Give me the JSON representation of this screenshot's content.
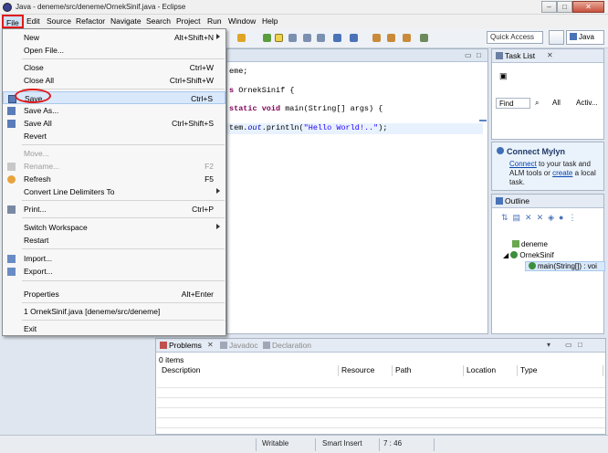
{
  "window": {
    "title": "Java - deneme/src/deneme/OrnekSinif.java - Eclipse",
    "minimize": "–",
    "maximize": "□",
    "close": "✕"
  },
  "menubar": [
    "File",
    "Edit",
    "Source",
    "Refactor",
    "Navigate",
    "Search",
    "Project",
    "Run",
    "Window",
    "Help"
  ],
  "toolbar": {
    "quick_access": "Quick Access",
    "perspective": "Java"
  },
  "editor": {
    "lines": [
      {
        "plain": "eme;"
      },
      {
        "kw": "s",
        "plain": " OrnekSinif {"
      },
      {
        "kw": "static void",
        "plain": " main(String[] args) {"
      },
      {
        "pre": "tem.",
        "it": "out",
        "post": ".println(",
        "str": "\"Hello World!..\"",
        "end": ");"
      }
    ]
  },
  "task_list": {
    "title": "Task List",
    "find_placeholder": "Find",
    "all": "All",
    "activate": "Activ..."
  },
  "mylyn": {
    "title": "Connect Mylyn",
    "connect_link": "Connect",
    "text_1": " to your task and ALM tools or ",
    "create_link": "create",
    "text_2": " a local task."
  },
  "outline": {
    "title": "Outline",
    "items": [
      "deneme",
      "OrnekSinif",
      "main(String[]) : voi"
    ]
  },
  "problems": {
    "tabs": [
      "Problems",
      "Javadoc",
      "Declaration"
    ],
    "count": "0 items",
    "columns": [
      "Description",
      "Resource",
      "Path",
      "Location",
      "Type"
    ]
  },
  "status": {
    "writable": "Writable",
    "insert_mode": "Smart Insert",
    "position": "7 : 46"
  },
  "file_menu": {
    "items": [
      {
        "label": "New",
        "accel": "Alt+Shift+N",
        "submenu": true,
        "disabled": false
      },
      {
        "label": "Open File...",
        "accel": "",
        "submenu": false,
        "disabled": false
      },
      {
        "label": "Close",
        "accel": "Ctrl+W",
        "submenu": false,
        "disabled": false
      },
      {
        "label": "Close All",
        "accel": "Ctrl+Shift+W",
        "submenu": false,
        "disabled": false
      },
      {
        "label": "Save",
        "accel": "Ctrl+S",
        "submenu": false,
        "disabled": false
      },
      {
        "label": "Save As...",
        "accel": "",
        "submenu": false,
        "disabled": false
      },
      {
        "label": "Save All",
        "accel": "Ctrl+Shift+S",
        "submenu": false,
        "disabled": false
      },
      {
        "label": "Revert",
        "accel": "",
        "submenu": false,
        "disabled": false
      },
      {
        "label": "Move...",
        "accel": "",
        "submenu": false,
        "disabled": true
      },
      {
        "label": "Rename...",
        "accel": "F2",
        "submenu": false,
        "disabled": true
      },
      {
        "label": "Refresh",
        "accel": "F5",
        "submenu": false,
        "disabled": false
      },
      {
        "label": "Convert Line Delimiters To",
        "accel": "",
        "submenu": true,
        "disabled": false
      },
      {
        "label": "Print...",
        "accel": "Ctrl+P",
        "submenu": false,
        "disabled": false
      },
      {
        "label": "Switch Workspace",
        "accel": "",
        "submenu": true,
        "disabled": false
      },
      {
        "label": "Restart",
        "accel": "",
        "submenu": false,
        "disabled": false
      },
      {
        "label": "Import...",
        "accel": "",
        "submenu": false,
        "disabled": false
      },
      {
        "label": "Export...",
        "accel": "",
        "submenu": false,
        "disabled": false
      },
      {
        "label": "Properties",
        "accel": "Alt+Enter",
        "submenu": false,
        "disabled": false
      },
      {
        "label": "1 OrnekSinif.java  [deneme/src/deneme]",
        "accel": "",
        "submenu": false,
        "disabled": false
      },
      {
        "label": "Exit",
        "accel": "",
        "submenu": false,
        "disabled": false
      }
    ]
  },
  "colors": {
    "annotation": "#e01a1a",
    "keyword": "#7f0055",
    "string": "#2a00ff",
    "link": "#0645ad"
  }
}
